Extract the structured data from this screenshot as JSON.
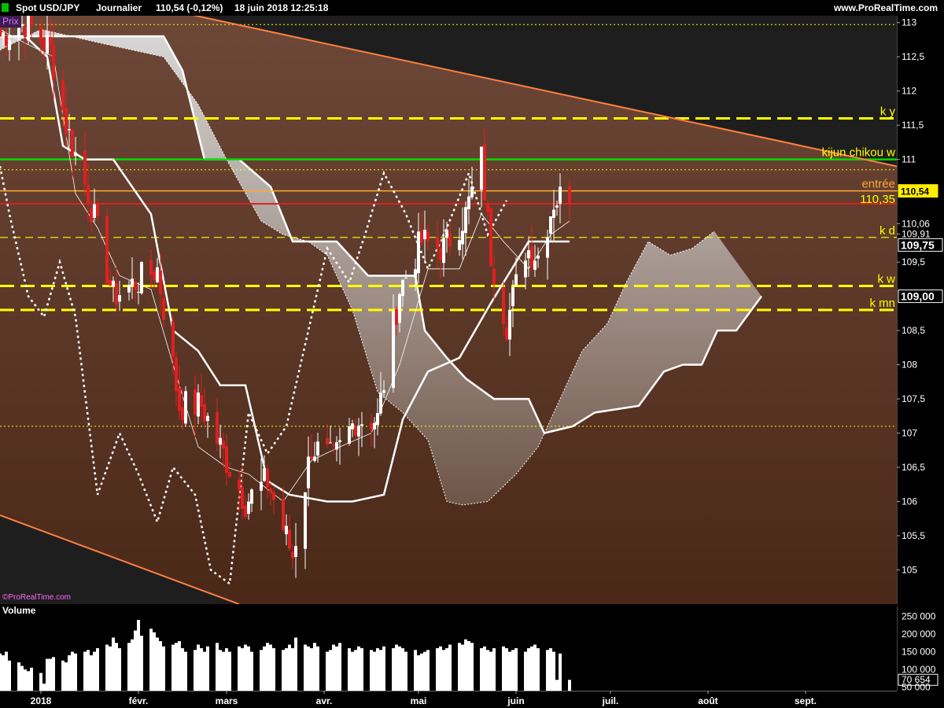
{
  "header": {
    "title": "Spot USD/JPY",
    "timeframe": "Journalier",
    "last": "110,54 (-0,12%)",
    "datetime": "18 juin 2018 12:25:18",
    "site": "www.ProRealTime.com"
  },
  "panel_labels": {
    "price": "Prix",
    "volume": "Volume",
    "watermark": "©ProRealTime.com"
  },
  "colors": {
    "bull": "#ffffff",
    "bear": "#e02020",
    "accent": "#ffff00",
    "trendline": "#ff8040",
    "green_line": "#00dd00",
    "entry_line": "#ffaa33",
    "stop_line": "#dd2020"
  },
  "chart_data": [
    {
      "type": "candlestick",
      "title": "Spot USD/JPY",
      "ylim": [
        104.5,
        113.1
      ],
      "y_ticks": [
        {
          "value": 113,
          "label": "113"
        },
        {
          "value": 112.5,
          "label": "112,5"
        },
        {
          "value": 112,
          "label": "112"
        },
        {
          "value": 111.5,
          "label": "111,5"
        },
        {
          "value": 111,
          "label": "111"
        },
        {
          "value": 110.54,
          "label": "110,54"
        },
        {
          "value": 110.06,
          "label": "110,06"
        },
        {
          "value": 109.91,
          "label": "109,91"
        },
        {
          "value": 109.5,
          "label": "109,5"
        },
        {
          "value": 108.5,
          "label": "108,5"
        },
        {
          "value": 108,
          "label": "108"
        },
        {
          "value": 107.5,
          "label": "107,5"
        },
        {
          "value": 107,
          "label": "107"
        },
        {
          "value": 106.5,
          "label": "106,5"
        },
        {
          "value": 106,
          "label": "106"
        },
        {
          "value": 105.5,
          "label": "105,5"
        },
        {
          "value": 105,
          "label": "105"
        }
      ],
      "price_tags": [
        {
          "value": 110.54,
          "label": "110,54",
          "style": "yellow"
        },
        {
          "value": 109.75,
          "label": "109,75",
          "style": "white"
        },
        {
          "value": 109.0,
          "label": "109,00",
          "style": "white"
        }
      ],
      "x_start": "2017-12-19",
      "x_end": "2018-09-30",
      "x_ticks": [
        {
          "date": "2018-01-01",
          "label": "2018"
        },
        {
          "date": "2018-02-01",
          "label": "févr."
        },
        {
          "date": "2018-03-01",
          "label": "mars"
        },
        {
          "date": "2018-04-01",
          "label": "avr."
        },
        {
          "date": "2018-05-01",
          "label": "mai"
        },
        {
          "date": "2018-06-01",
          "label": "juin"
        },
        {
          "date": "2018-07-01",
          "label": "juil."
        },
        {
          "date": "2018-08-01",
          "label": "août"
        },
        {
          "date": "2018-09-01",
          "label": "sept."
        }
      ],
      "levels": [
        {
          "value": 111.6,
          "label": "k y",
          "style": "yellow-dash"
        },
        {
          "value": 111.0,
          "label": "kijun chikou w",
          "style": "green"
        },
        {
          "value": 110.54,
          "label": "entrée",
          "style": "orange"
        },
        {
          "value": 110.35,
          "label": "110,35",
          "style": "red"
        },
        {
          "value": 109.86,
          "label": "k d",
          "style": "yellow-dash-thin"
        },
        {
          "value": 109.15,
          "label": "k w",
          "style": "yellow-dash"
        },
        {
          "value": 108.8,
          "label": "k mn",
          "style": "yellow-dash"
        },
        {
          "value": 112.97,
          "label": "",
          "style": "yellow-dot"
        },
        {
          "value": 110.85,
          "label": "",
          "style": "yellow-dot"
        },
        {
          "value": 107.1,
          "label": "",
          "style": "yellow-dot"
        }
      ],
      "trendlines": [
        {
          "from": [
            "2018-01-30",
            113.3
          ],
          "to": [
            "2018-09-30",
            110.9
          ]
        },
        {
          "from": [
            "2017-12-19",
            105.8
          ],
          "to": [
            "2018-03-05",
            104.5
          ]
        }
      ],
      "candles_anchors": [
        [
          "2017-12-19",
          112.8
        ],
        [
          "2017-12-27",
          113.0
        ],
        [
          "2018-01-04",
          112.6
        ],
        [
          "2018-01-09",
          111.5
        ],
        [
          "2018-01-16",
          110.5
        ],
        [
          "2018-01-24",
          109.0
        ],
        [
          "2018-01-31",
          109.2
        ],
        [
          "2018-02-07",
          109.4
        ],
        [
          "2018-02-14",
          107.4
        ],
        [
          "2018-02-21",
          107.4
        ],
        [
          "2018-02-28",
          106.7
        ],
        [
          "2018-03-07",
          106.0
        ],
        [
          "2018-03-14",
          106.3
        ],
        [
          "2018-03-22",
          105.2
        ],
        [
          "2018-03-28",
          106.8
        ],
        [
          "2018-04-04",
          106.6
        ],
        [
          "2018-04-11",
          107.2
        ],
        [
          "2018-04-18",
          107.2
        ],
        [
          "2018-04-25",
          109.1
        ],
        [
          "2018-05-02",
          109.8
        ],
        [
          "2018-05-09",
          109.7
        ],
        [
          "2018-05-16",
          110.2
        ],
        [
          "2018-05-21",
          111.0
        ],
        [
          "2018-05-24",
          109.6
        ],
        [
          "2018-05-29",
          108.6
        ],
        [
          "2018-06-04",
          109.7
        ],
        [
          "2018-06-08",
          109.6
        ],
        [
          "2018-06-13",
          110.4
        ],
        [
          "2018-06-18",
          110.54
        ]
      ],
      "kijun": [
        [
          "2017-12-19",
          112.8
        ],
        [
          "2017-12-27",
          112.8
        ],
        [
          "2018-01-03",
          112.5
        ],
        [
          "2018-01-08",
          111.2
        ],
        [
          "2018-01-15",
          111.0
        ],
        [
          "2018-01-24",
          111.0
        ],
        [
          "2018-02-05",
          110.2
        ],
        [
          "2018-02-12",
          108.5
        ],
        [
          "2018-02-20",
          108.2
        ],
        [
          "2018-02-27",
          107.7
        ],
        [
          "2018-03-07",
          107.7
        ],
        [
          "2018-03-14",
          106.3
        ],
        [
          "2018-03-21",
          106.1
        ],
        [
          "2018-04-02",
          106.0
        ],
        [
          "2018-04-10",
          106.0
        ],
        [
          "2018-04-20",
          106.1
        ],
        [
          "2018-04-26",
          107.2
        ],
        [
          "2018-05-04",
          107.9
        ],
        [
          "2018-05-14",
          108.1
        ],
        [
          "2018-05-24",
          108.9
        ],
        [
          "2018-06-05",
          109.8
        ],
        [
          "2018-06-18",
          109.8
        ]
      ],
      "tenkan": [
        [
          "2017-12-19",
          112.9
        ],
        [
          "2017-12-27",
          112.7
        ],
        [
          "2018-01-05",
          112.5
        ],
        [
          "2018-01-12",
          110.5
        ],
        [
          "2018-01-19",
          110.0
        ],
        [
          "2018-01-26",
          109.3
        ],
        [
          "2018-02-05",
          109.1
        ],
        [
          "2018-02-12",
          108.0
        ],
        [
          "2018-02-20",
          106.8
        ],
        [
          "2018-03-01",
          106.5
        ],
        [
          "2018-03-08",
          106.4
        ],
        [
          "2018-03-19",
          106.0
        ],
        [
          "2018-03-28",
          106.6
        ],
        [
          "2018-04-06",
          106.8
        ],
        [
          "2018-04-16",
          107.0
        ],
        [
          "2018-04-25",
          108.0
        ],
        [
          "2018-05-04",
          109.4
        ],
        [
          "2018-05-14",
          109.4
        ],
        [
          "2018-05-21",
          110.2
        ],
        [
          "2018-05-28",
          109.8
        ],
        [
          "2018-06-05",
          109.4
        ],
        [
          "2018-06-12",
          109.9
        ],
        [
          "2018-06-18",
          110.1
        ]
      ],
      "ssa": [
        [
          "2017-12-19",
          112.6
        ],
        [
          "2018-01-01",
          112.9
        ],
        [
          "2018-01-20",
          112.7
        ],
        [
          "2018-02-09",
          112.5
        ],
        [
          "2018-02-20",
          111.8
        ],
        [
          "2018-03-01",
          111.0
        ],
        [
          "2018-03-12",
          110.1
        ],
        [
          "2018-03-19",
          109.9
        ],
        [
          "2018-03-27",
          109.8
        ],
        [
          "2018-04-02",
          109.6
        ],
        [
          "2018-04-10",
          108.8
        ],
        [
          "2018-04-18",
          107.6
        ],
        [
          "2018-04-26",
          107.3
        ],
        [
          "2018-05-04",
          106.9
        ],
        [
          "2018-05-10",
          106.0
        ],
        [
          "2018-05-15",
          105.95
        ],
        [
          "2018-05-23",
          106.0
        ],
        [
          "2018-06-01",
          106.4
        ],
        [
          "2018-06-08",
          106.8
        ],
        [
          "2018-06-15",
          107.5
        ],
        [
          "2018-06-22",
          108.2
        ],
        [
          "2018-06-30",
          108.6
        ],
        [
          "2018-07-06",
          109.2
        ],
        [
          "2018-07-13",
          109.8
        ],
        [
          "2018-07-20",
          109.6
        ],
        [
          "2018-07-27",
          109.7
        ],
        [
          "2018-08-03",
          109.95
        ]
      ],
      "ssb": [
        [
          "2017-12-19",
          112.8
        ],
        [
          "2018-01-31",
          112.8
        ],
        [
          "2018-02-09",
          112.8
        ],
        [
          "2018-02-15",
          112.3
        ],
        [
          "2018-02-22",
          111.0
        ],
        [
          "2018-03-05",
          111.0
        ],
        [
          "2018-03-15",
          110.6
        ],
        [
          "2018-03-22",
          109.8
        ],
        [
          "2018-04-05",
          109.8
        ],
        [
          "2018-04-15",
          109.3
        ],
        [
          "2018-04-30",
          109.3
        ],
        [
          "2018-05-03",
          108.5
        ],
        [
          "2018-05-10",
          108.1
        ],
        [
          "2018-05-16",
          107.8
        ],
        [
          "2018-05-25",
          107.5
        ],
        [
          "2018-06-05",
          107.5
        ],
        [
          "2018-06-10",
          107.0
        ],
        [
          "2018-06-19",
          107.1
        ],
        [
          "2018-06-26",
          107.3
        ],
        [
          "2018-07-10",
          107.4
        ],
        [
          "2018-07-18",
          107.9
        ],
        [
          "2018-07-24",
          108.0
        ],
        [
          "2018-07-30",
          108.0
        ],
        [
          "2018-08-04",
          108.5
        ],
        [
          "2018-08-10",
          108.5
        ],
        [
          "2018-08-18",
          109.0
        ]
      ],
      "chikou": [
        [
          "2017-12-19",
          110.9
        ],
        [
          "2017-12-22",
          110.2
        ],
        [
          "2017-12-28",
          109.0
        ],
        [
          "2018-01-02",
          108.7
        ],
        [
          "2018-01-07",
          109.5
        ],
        [
          "2018-01-12",
          108.7
        ],
        [
          "2018-01-19",
          106.1
        ],
        [
          "2018-01-26",
          107.0
        ],
        [
          "2018-02-01",
          106.4
        ],
        [
          "2018-02-07",
          105.7
        ],
        [
          "2018-02-12",
          106.5
        ],
        [
          "2018-02-19",
          106.1
        ],
        [
          "2018-02-24",
          105.0
        ],
        [
          "2018-03-02",
          104.8
        ],
        [
          "2018-03-08",
          107.3
        ],
        [
          "2018-03-14",
          106.7
        ],
        [
          "2018-03-20",
          107.1
        ],
        [
          "2018-03-27",
          108.5
        ],
        [
          "2018-04-02",
          109.7
        ],
        [
          "2018-04-09",
          109.2
        ],
        [
          "2018-04-14",
          109.9
        ],
        [
          "2018-04-20",
          110.8
        ],
        [
          "2018-04-27",
          110.2
        ],
        [
          "2018-05-04",
          109.4
        ],
        [
          "2018-05-10",
          110.0
        ],
        [
          "2018-05-17",
          110.8
        ],
        [
          "2018-05-23",
          109.9
        ],
        [
          "2018-05-29",
          110.4
        ]
      ],
      "volume_ylim": [
        40000,
        280000
      ],
      "volume_ticks": [
        {
          "value": 250000,
          "label": "250 000"
        },
        {
          "value": 200000,
          "label": "200 000"
        },
        {
          "value": 150000,
          "label": "150 000"
        },
        {
          "value": 100000,
          "label": "100 000"
        },
        {
          "value": 70654,
          "label": "70 654"
        },
        {
          "value": 50000,
          "label": "50 000"
        }
      ],
      "volumes": [
        145000,
        140000,
        150000,
        125000,
        120000,
        110000,
        100000,
        95000,
        105000,
        90000,
        60000,
        130000,
        130000,
        135000,
        125000,
        120000,
        140000,
        150000,
        145000,
        150000,
        155000,
        140000,
        150000,
        160000,
        170000,
        165000,
        190000,
        175000,
        160000,
        175000,
        185000,
        210000,
        240000,
        195000,
        215000,
        205000,
        190000,
        180000,
        165000,
        170000,
        175000,
        180000,
        160000,
        150000,
        155000,
        170000,
        160000,
        150000,
        165000,
        175000,
        155000,
        150000,
        160000,
        150000,
        165000,
        160000,
        170000,
        165000,
        150000,
        155000,
        165000,
        175000,
        170000,
        160000,
        155000,
        160000,
        170000,
        160000,
        190000,
        170000,
        165000,
        160000,
        175000,
        165000,
        150000,
        155000,
        170000,
        165000,
        175000,
        160000,
        150000,
        155000,
        165000,
        160000,
        155000,
        150000,
        160000,
        155000,
        165000,
        160000,
        170000,
        165000,
        160000,
        150000,
        155000,
        140000,
        145000,
        150000,
        155000,
        160000,
        165000,
        155000,
        160000,
        170000,
        175000,
        170000,
        185000,
        180000,
        175000,
        160000,
        165000,
        155000,
        150000,
        160000,
        165000,
        160000,
        150000,
        155000,
        160000,
        150000,
        160000,
        165000,
        170000,
        160000,
        155000,
        160000,
        150000,
        70654
      ]
    }
  ]
}
